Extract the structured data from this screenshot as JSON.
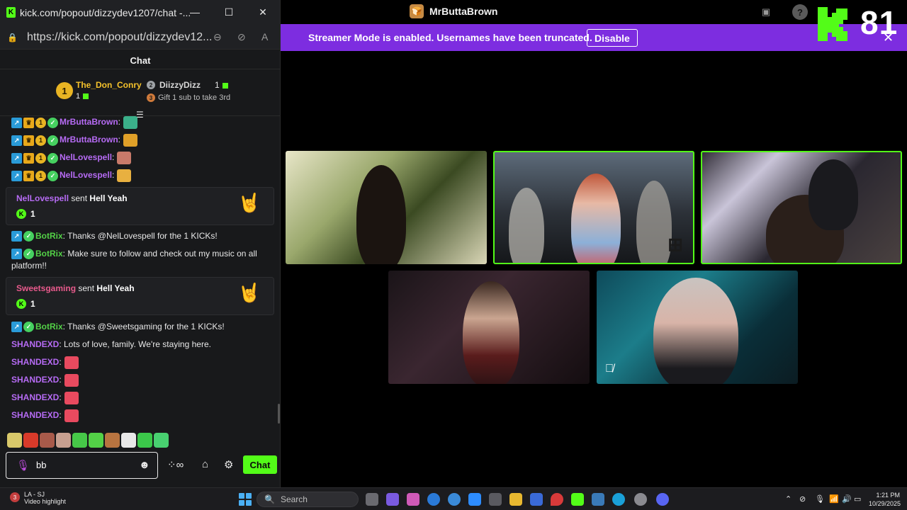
{
  "browser": {
    "window_title": "kick.com/popout/dizzydev1207/chat -...",
    "url": "https://kick.com/popout/dizzydev12..."
  },
  "stream": {
    "channel_name": "MrButtaBrown",
    "streamer_mode_text": "Streamer Mode is enabled. Usernames have been truncated.",
    "disable_label": "Disable",
    "viewer_count": "81"
  },
  "chat": {
    "title": "Chat",
    "leaderboard": {
      "first": {
        "rank": "1",
        "name": "The_Don_Conry",
        "count": "1"
      },
      "second": {
        "rank": "2",
        "name": "DiizzyDizz",
        "count": "1"
      },
      "third": {
        "rank": "3",
        "text": "Gift 1 sub to take 3rd"
      }
    },
    "messages": [
      {
        "user": "MrButtaBrown",
        "text": ":"
      },
      {
        "user": "MrButtaBrown",
        "text": ":"
      },
      {
        "user": "NelLovespell",
        "text": ":"
      },
      {
        "user": "NelLovespell",
        "text": ":"
      }
    ],
    "gift_cards": [
      {
        "user": "NelLovespell",
        "action": "sent",
        "item": "Hell Yeah",
        "amount": "1",
        "emoji": "🤘"
      },
      {
        "user": "Sweetsgaming",
        "action": "sent",
        "item": "Hell Yeah",
        "amount": "1",
        "emoji": "🤘"
      }
    ],
    "bot_messages": [
      {
        "user": "BotRix",
        "text": ": Thanks @NelLovespell for the 1 KICKs!"
      },
      {
        "user": "BotRix",
        "text": ": Make sure to follow and check out my music on all platform!!"
      },
      {
        "user": "BotRix",
        "text": ": Thanks @Sweetsgaming for the 1 KICKs!"
      }
    ],
    "shand_messages": [
      {
        "user": "SHANDEXD",
        "text": ": Lots of love, family. We're staying here."
      },
      {
        "user": "SHANDEXD",
        "text": ":"
      },
      {
        "user": "SHANDEXD",
        "text": ":"
      },
      {
        "user": "SHANDEXD",
        "text": ":"
      },
      {
        "user": "SHANDEXD",
        "text": ":"
      }
    ],
    "input_value": "bb",
    "send_label": "Chat"
  },
  "taskbar": {
    "weather_location": "LA - SJ",
    "weather_sub": "Video highlight",
    "weather_badge": "3",
    "search_label": "Search",
    "time": "1:21 PM",
    "date": "10/29/2025"
  },
  "colors": {
    "kick_green": "#53fc18",
    "streamer_bar": "#7d2de0",
    "username_purple": "#b66bf4",
    "bot_green": "#53d147",
    "username_pink": "#e85a8c",
    "gold": "#f5c22b"
  }
}
